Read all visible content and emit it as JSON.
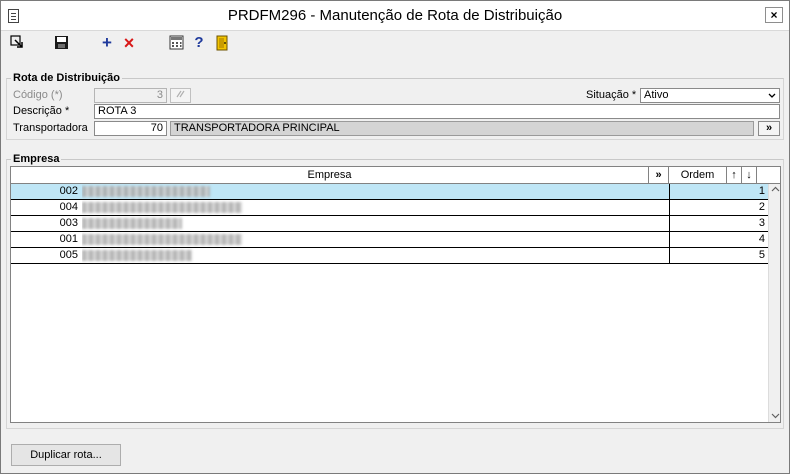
{
  "window": {
    "title": "PRDFM296 - Manutenção de Rota de Distribuição",
    "close_label": "×"
  },
  "toolbar": {
    "icons": [
      "exit-icon",
      "save-icon",
      "add-icon",
      "delete-icon",
      "calculator-icon",
      "help-icon",
      "door-icon"
    ],
    "add_label": "+",
    "delete_label": "×",
    "help_label": "?"
  },
  "route": {
    "section_title": "Rota de Distribuição",
    "code_label": "Código (*)",
    "code_value": "3",
    "description_label": "Descrição *",
    "description_value": "ROTA 3",
    "carrier_label": "Transportadora",
    "carrier_code": "70",
    "carrier_name": "TRANSPORTADORA PRINCIPAL",
    "carrier_lookup": "»",
    "status_label": "Situação *",
    "status_value": "Ativo"
  },
  "companies": {
    "section_title": "Empresa",
    "col_company": "Empresa",
    "col_order": "Ordem",
    "expand_label": "»",
    "up_label": "↑",
    "down_label": "↓",
    "rows": [
      {
        "code": "002",
        "order": "1"
      },
      {
        "code": "004",
        "order": "2"
      },
      {
        "code": "003",
        "order": "3"
      },
      {
        "code": "001",
        "order": "4"
      },
      {
        "code": "005",
        "order": "5"
      }
    ]
  },
  "footer": {
    "duplicate_label": "Duplicar rota..."
  },
  "colors": {
    "selected_row": "#bfe6f6",
    "window_bg": "#f0f0f0"
  }
}
